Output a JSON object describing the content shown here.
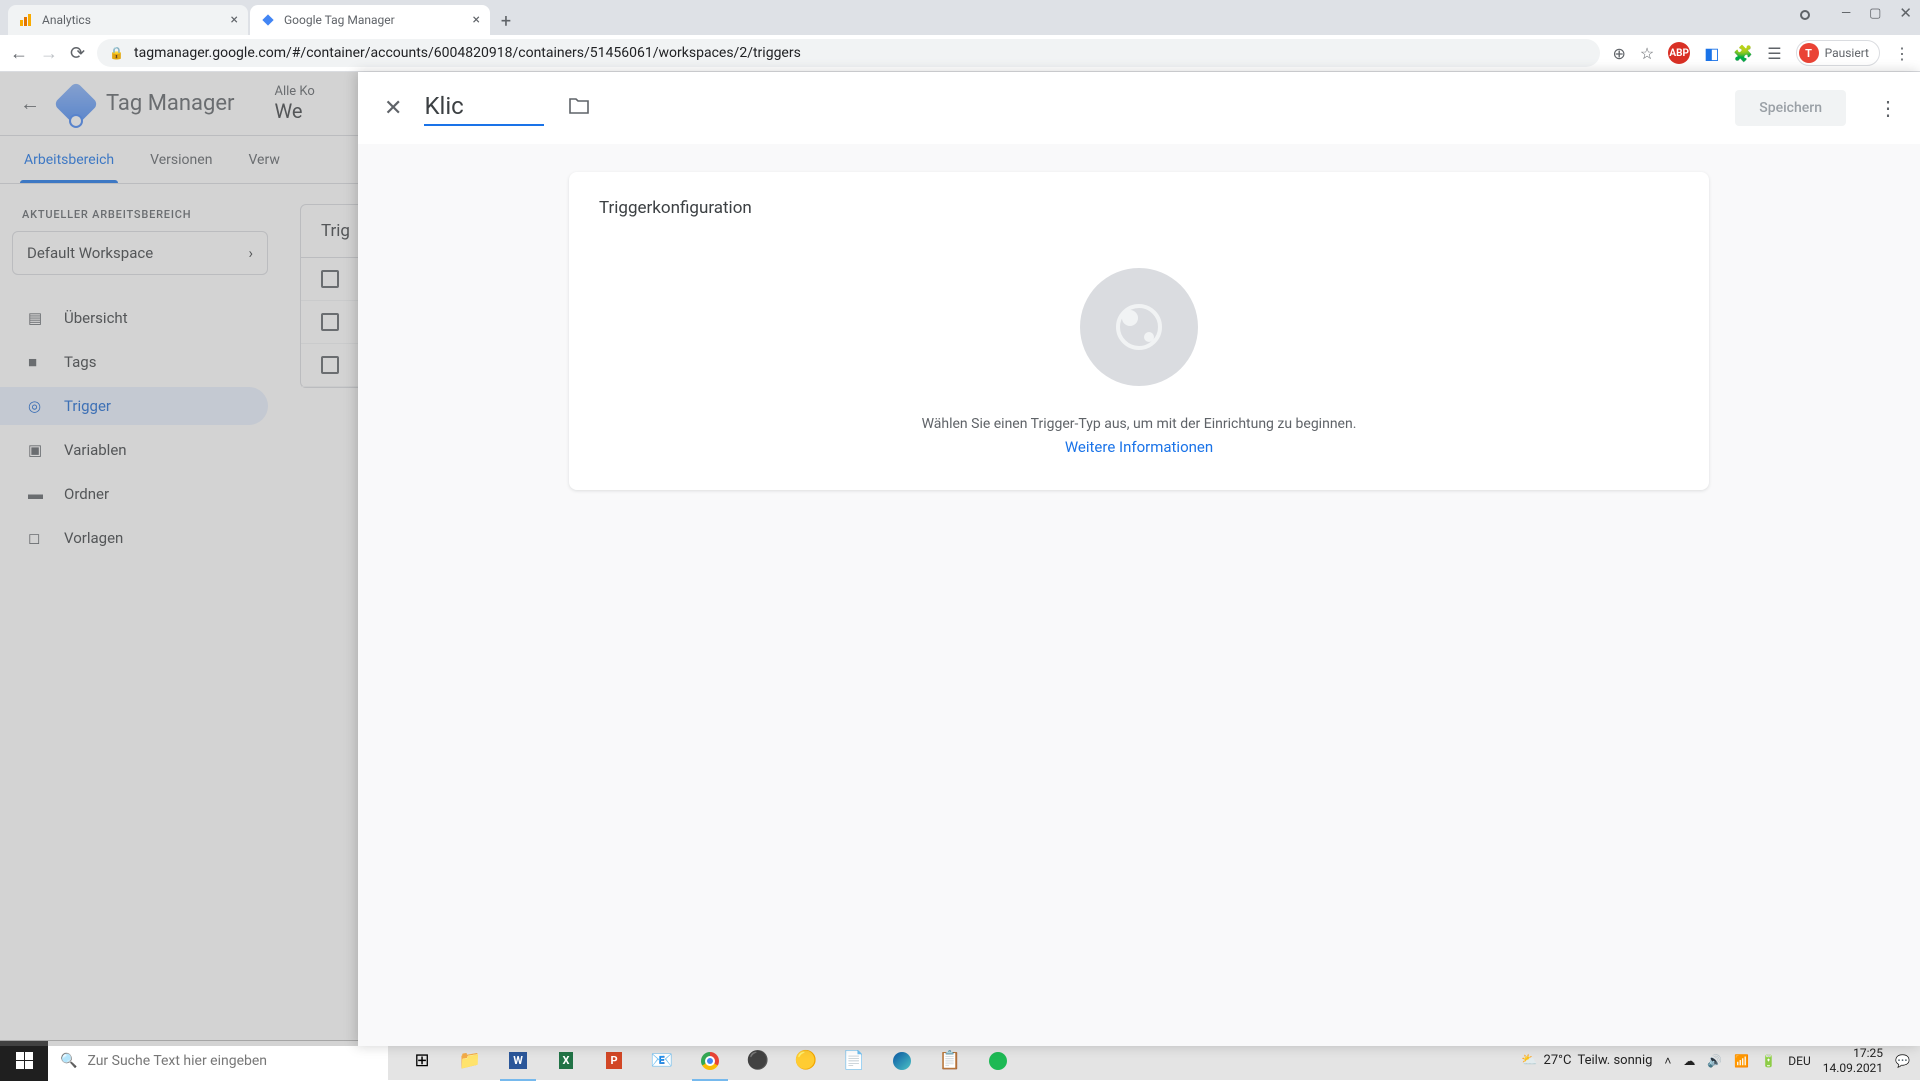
{
  "browser": {
    "tabs": [
      {
        "title": "Analytics",
        "icon_color": "#f9ab00"
      },
      {
        "title": "Google Tag Manager",
        "icon_color": "#4285f4"
      }
    ],
    "url": "tagmanager.google.com/#/container/accounts/6004820918/containers/51456061/workspaces/2/triggers",
    "profile_label": "Pausiert",
    "profile_initial": "T"
  },
  "gtm": {
    "app_title": "Tag Manager",
    "account_line1": "Alle Ko",
    "account_line2": "We",
    "tabs": {
      "workspace": "Arbeitsbereich",
      "versions": "Versionen",
      "admin": "Verw"
    },
    "workspace_label": "AKTUELLER ARBEITSBEREICH",
    "workspace_name": "Default Workspace",
    "nav": {
      "overview": "Übersicht",
      "tags": "Tags",
      "triggers": "Trigger",
      "variables": "Variablen",
      "folders": "Ordner",
      "templates": "Vorlagen"
    },
    "list_heading": "Trig"
  },
  "modal": {
    "name_value": "Klic",
    "save_label": "Speichern",
    "config_title": "Triggerkonfiguration",
    "hint": "Wählen Sie einen Trigger-Typ aus, um mit der Einrichtung zu beginnen.",
    "link": "Weitere Informationen"
  },
  "taskbar": {
    "search_placeholder": "Zur Suche Text hier eingeben",
    "weather_temp": "27°C",
    "weather_desc": "Teilw. sonnig",
    "lang": "DEU",
    "time": "17:25",
    "date": "14.09.2021"
  }
}
